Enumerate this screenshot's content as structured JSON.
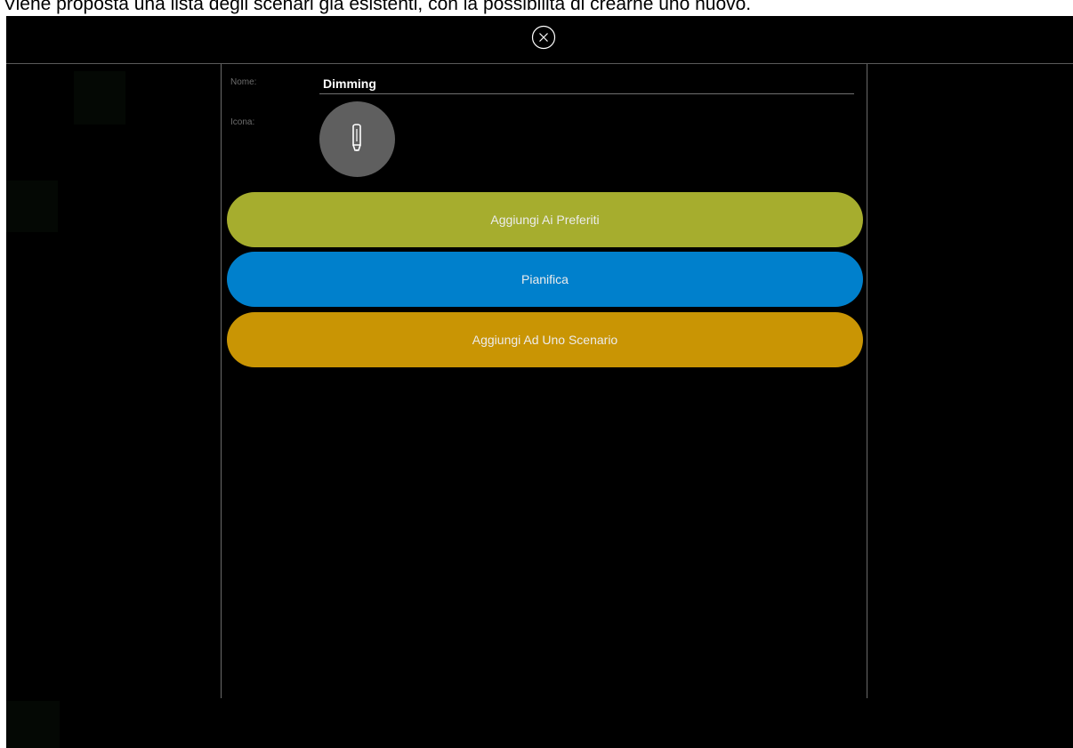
{
  "caption": "Viene proposta una lista degli scenari già esistenti, con la possibilità di crearne uno nuovo.",
  "topbar": {
    "close_icon": "close-circle-icon"
  },
  "form": {
    "name_label": "Nome:",
    "name_value": "Dimming",
    "icon_label": "Icona:",
    "icon": "bulb-icon"
  },
  "actions": {
    "favorites_label": "Aggiungi Ai Preferiti",
    "favorites_color": "#a6ad2e",
    "schedule_label": "Pianifica",
    "schedule_color": "#0080cc",
    "scenario_label": "Aggiungi Ad Uno Scenario",
    "scenario_color": "#c99504"
  }
}
